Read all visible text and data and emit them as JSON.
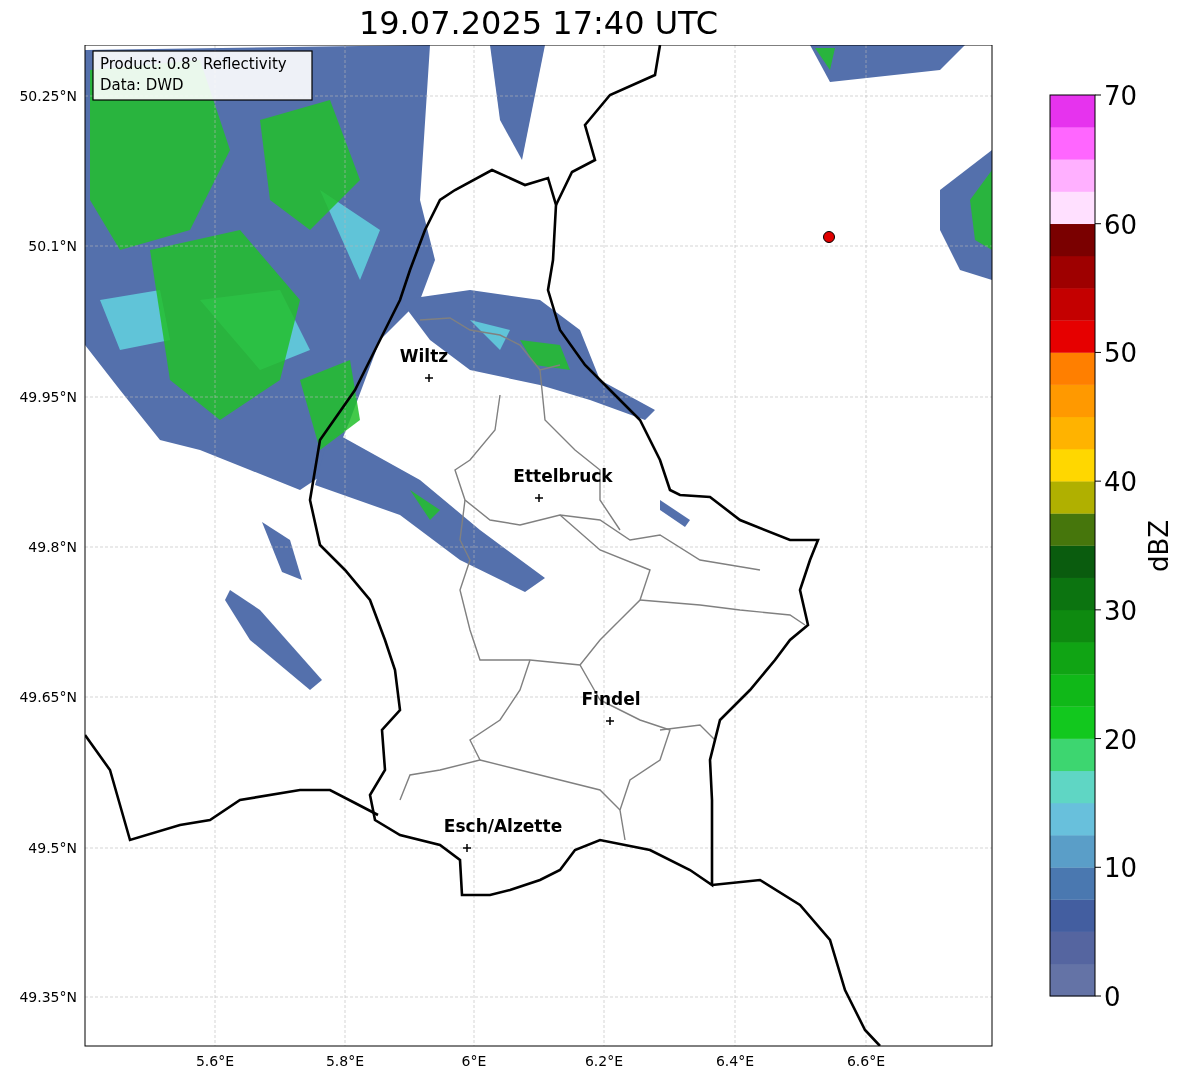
{
  "title": "19.07.2025 17:40 UTC",
  "info_box": [
    "Product: 0.8° Reflectivity",
    "Data: DWD"
  ],
  "x_ticks": [
    "5.6°E",
    "5.8°E",
    "6°E",
    "6.2°E",
    "6.4°E",
    "6.6°E"
  ],
  "y_ticks": [
    "50.25°N",
    "50.1°N",
    "49.95°N",
    "49.8°N",
    "49.65°N",
    "49.5°N",
    "49.35°N"
  ],
  "cities": [
    {
      "name": "Wiltz"
    },
    {
      "name": "Ettelbruck"
    },
    {
      "name": "Findel"
    },
    {
      "name": "Esch/Alzette"
    }
  ],
  "colorbar": {
    "label": "dBZ",
    "ticks": [
      "70",
      "60",
      "50",
      "40",
      "30",
      "20",
      "10",
      "0"
    ],
    "bins": [
      {
        "color": "#6473a6"
      },
      {
        "color": "#5565a0"
      },
      {
        "color": "#435ea0"
      },
      {
        "color": "#4a78b0"
      },
      {
        "color": "#5a9ec8"
      },
      {
        "color": "#68c0dc"
      },
      {
        "color": "#5fd6c4"
      },
      {
        "color": "#3dd670"
      },
      {
        "color": "#12c81e"
      },
      {
        "color": "#10b818"
      },
      {
        "color": "#10a414"
      },
      {
        "color": "#0e8a10"
      },
      {
        "color": "#0c7410"
      },
      {
        "color": "#0a5c0e"
      },
      {
        "color": "#46760c"
      },
      {
        "color": "#b0b000"
      },
      {
        "color": "#ffd700"
      },
      {
        "color": "#ffb300"
      },
      {
        "color": "#ff9900"
      },
      {
        "color": "#ff7f00"
      },
      {
        "color": "#e60000"
      },
      {
        "color": "#c40000"
      },
      {
        "color": "#9e0000"
      },
      {
        "color": "#7a0000"
      },
      {
        "color": "#ffe0ff"
      },
      {
        "color": "#ffb0ff"
      },
      {
        "color": "#ff66ff"
      },
      {
        "color": "#e633ee"
      }
    ]
  }
}
